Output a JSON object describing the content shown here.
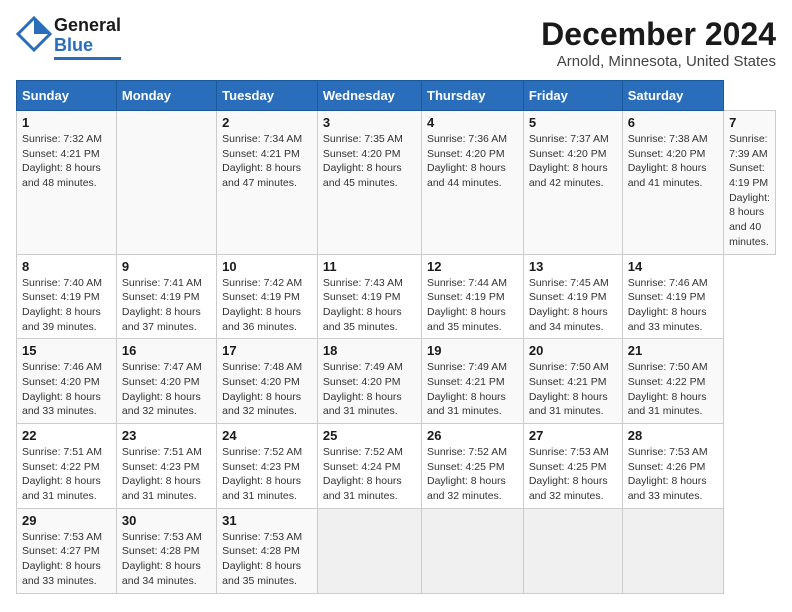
{
  "header": {
    "logo_general": "General",
    "logo_blue": "Blue",
    "main_title": "December 2024",
    "subtitle": "Arnold, Minnesota, United States"
  },
  "calendar": {
    "days_of_week": [
      "Sunday",
      "Monday",
      "Tuesday",
      "Wednesday",
      "Thursday",
      "Friday",
      "Saturday"
    ],
    "weeks": [
      [
        null,
        {
          "day": 2,
          "sunrise": "Sunrise: 7:34 AM",
          "sunset": "Sunset: 4:21 PM",
          "daylight": "Daylight: 8 hours and 47 minutes."
        },
        {
          "day": 3,
          "sunrise": "Sunrise: 7:35 AM",
          "sunset": "Sunset: 4:20 PM",
          "daylight": "Daylight: 8 hours and 45 minutes."
        },
        {
          "day": 4,
          "sunrise": "Sunrise: 7:36 AM",
          "sunset": "Sunset: 4:20 PM",
          "daylight": "Daylight: 8 hours and 44 minutes."
        },
        {
          "day": 5,
          "sunrise": "Sunrise: 7:37 AM",
          "sunset": "Sunset: 4:20 PM",
          "daylight": "Daylight: 8 hours and 42 minutes."
        },
        {
          "day": 6,
          "sunrise": "Sunrise: 7:38 AM",
          "sunset": "Sunset: 4:20 PM",
          "daylight": "Daylight: 8 hours and 41 minutes."
        },
        {
          "day": 7,
          "sunrise": "Sunrise: 7:39 AM",
          "sunset": "Sunset: 4:19 PM",
          "daylight": "Daylight: 8 hours and 40 minutes."
        }
      ],
      [
        {
          "day": 8,
          "sunrise": "Sunrise: 7:40 AM",
          "sunset": "Sunset: 4:19 PM",
          "daylight": "Daylight: 8 hours and 39 minutes."
        },
        {
          "day": 9,
          "sunrise": "Sunrise: 7:41 AM",
          "sunset": "Sunset: 4:19 PM",
          "daylight": "Daylight: 8 hours and 37 minutes."
        },
        {
          "day": 10,
          "sunrise": "Sunrise: 7:42 AM",
          "sunset": "Sunset: 4:19 PM",
          "daylight": "Daylight: 8 hours and 36 minutes."
        },
        {
          "day": 11,
          "sunrise": "Sunrise: 7:43 AM",
          "sunset": "Sunset: 4:19 PM",
          "daylight": "Daylight: 8 hours and 35 minutes."
        },
        {
          "day": 12,
          "sunrise": "Sunrise: 7:44 AM",
          "sunset": "Sunset: 4:19 PM",
          "daylight": "Daylight: 8 hours and 35 minutes."
        },
        {
          "day": 13,
          "sunrise": "Sunrise: 7:45 AM",
          "sunset": "Sunset: 4:19 PM",
          "daylight": "Daylight: 8 hours and 34 minutes."
        },
        {
          "day": 14,
          "sunrise": "Sunrise: 7:46 AM",
          "sunset": "Sunset: 4:19 PM",
          "daylight": "Daylight: 8 hours and 33 minutes."
        }
      ],
      [
        {
          "day": 15,
          "sunrise": "Sunrise: 7:46 AM",
          "sunset": "Sunset: 4:20 PM",
          "daylight": "Daylight: 8 hours and 33 minutes."
        },
        {
          "day": 16,
          "sunrise": "Sunrise: 7:47 AM",
          "sunset": "Sunset: 4:20 PM",
          "daylight": "Daylight: 8 hours and 32 minutes."
        },
        {
          "day": 17,
          "sunrise": "Sunrise: 7:48 AM",
          "sunset": "Sunset: 4:20 PM",
          "daylight": "Daylight: 8 hours and 32 minutes."
        },
        {
          "day": 18,
          "sunrise": "Sunrise: 7:49 AM",
          "sunset": "Sunset: 4:20 PM",
          "daylight": "Daylight: 8 hours and 31 minutes."
        },
        {
          "day": 19,
          "sunrise": "Sunrise: 7:49 AM",
          "sunset": "Sunset: 4:21 PM",
          "daylight": "Daylight: 8 hours and 31 minutes."
        },
        {
          "day": 20,
          "sunrise": "Sunrise: 7:50 AM",
          "sunset": "Sunset: 4:21 PM",
          "daylight": "Daylight: 8 hours and 31 minutes."
        },
        {
          "day": 21,
          "sunrise": "Sunrise: 7:50 AM",
          "sunset": "Sunset: 4:22 PM",
          "daylight": "Daylight: 8 hours and 31 minutes."
        }
      ],
      [
        {
          "day": 22,
          "sunrise": "Sunrise: 7:51 AM",
          "sunset": "Sunset: 4:22 PM",
          "daylight": "Daylight: 8 hours and 31 minutes."
        },
        {
          "day": 23,
          "sunrise": "Sunrise: 7:51 AM",
          "sunset": "Sunset: 4:23 PM",
          "daylight": "Daylight: 8 hours and 31 minutes."
        },
        {
          "day": 24,
          "sunrise": "Sunrise: 7:52 AM",
          "sunset": "Sunset: 4:23 PM",
          "daylight": "Daylight: 8 hours and 31 minutes."
        },
        {
          "day": 25,
          "sunrise": "Sunrise: 7:52 AM",
          "sunset": "Sunset: 4:24 PM",
          "daylight": "Daylight: 8 hours and 31 minutes."
        },
        {
          "day": 26,
          "sunrise": "Sunrise: 7:52 AM",
          "sunset": "Sunset: 4:25 PM",
          "daylight": "Daylight: 8 hours and 32 minutes."
        },
        {
          "day": 27,
          "sunrise": "Sunrise: 7:53 AM",
          "sunset": "Sunset: 4:25 PM",
          "daylight": "Daylight: 8 hours and 32 minutes."
        },
        {
          "day": 28,
          "sunrise": "Sunrise: 7:53 AM",
          "sunset": "Sunset: 4:26 PM",
          "daylight": "Daylight: 8 hours and 33 minutes."
        }
      ],
      [
        {
          "day": 29,
          "sunrise": "Sunrise: 7:53 AM",
          "sunset": "Sunset: 4:27 PM",
          "daylight": "Daylight: 8 hours and 33 minutes."
        },
        {
          "day": 30,
          "sunrise": "Sunrise: 7:53 AM",
          "sunset": "Sunset: 4:28 PM",
          "daylight": "Daylight: 8 hours and 34 minutes."
        },
        {
          "day": 31,
          "sunrise": "Sunrise: 7:53 AM",
          "sunset": "Sunset: 4:28 PM",
          "daylight": "Daylight: 8 hours and 35 minutes."
        },
        null,
        null,
        null,
        null
      ]
    ],
    "week1_day1": {
      "day": 1,
      "sunrise": "Sunrise: 7:32 AM",
      "sunset": "Sunset: 4:21 PM",
      "daylight": "Daylight: 8 hours and 48 minutes."
    }
  }
}
